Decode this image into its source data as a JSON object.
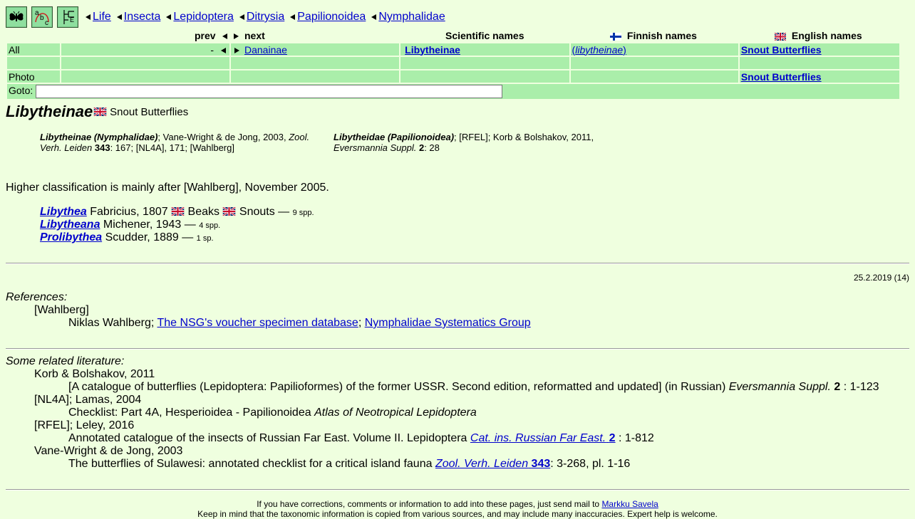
{
  "toolbar": {
    "icons": [
      "butterfly-icon",
      "abc-icon",
      "tree-icon"
    ],
    "abc_label": "abc"
  },
  "breadcrumbs": [
    {
      "label": "Life"
    },
    {
      "label": "Insecta"
    },
    {
      "label": "Lepidoptera"
    },
    {
      "label": "Ditrysia"
    },
    {
      "label": "Papilionoidea"
    },
    {
      "label": "Nymphalidae"
    }
  ],
  "nav": {
    "headers": {
      "prev": "prev",
      "next": "next",
      "scientific": "Scientific names",
      "finnish": "Finnish names",
      "english": "English names"
    },
    "rows": [
      {
        "label": "All",
        "prev": "-",
        "next": "Danainae",
        "scientific": "Libytheinae",
        "finnish": "(libytheinae)",
        "english": "Snout Butterflies"
      },
      {
        "label": "",
        "prev": "",
        "next": "",
        "scientific": "",
        "finnish": "",
        "english": ""
      },
      {
        "label": "Photo",
        "prev": "",
        "next": "",
        "scientific": "",
        "finnish": "",
        "english": "Snout Butterflies"
      }
    ],
    "goto_label": "Goto:",
    "goto_value": ""
  },
  "taxon": {
    "name": "Libytheinae",
    "common_name": "Snout Butterflies"
  },
  "synonyms": [
    {
      "name": "Libytheinae (Nymphalidae)",
      "rest1": "; Vane-Wright & de Jong, 2003, ",
      "journal1": "Zool.",
      "line2_journal": "Verh. Leiden",
      "volume": "343",
      "rest2": ": 167; [NL4A], 171; [Wahlberg]"
    },
    {
      "name": "Libytheidae (Papilionoidea)",
      "rest1": "; [RFEL]; Korb & Bolshakov, 2011,",
      "journal1": "",
      "line2_journal": "Eversmannia Suppl.",
      "volume": "2",
      "rest2": ": 28"
    }
  ],
  "higher_classification": "Higher classification is mainly after [Wahlberg], November 2005.",
  "genera": [
    {
      "name": "Libythea",
      "author": " Fabricius, 1807 ",
      "common1": "Beaks",
      "common2": "Snouts",
      "dash": " — ",
      "count": "9 spp."
    },
    {
      "name": "Libytheana",
      "author": " Michener, 1943",
      "dash": " — ",
      "count": "4 spp."
    },
    {
      "name": "Prolibythea",
      "author": " Scudder, 1889",
      "dash": " — ",
      "count": "1 sp."
    }
  ],
  "date": "25.2.2019 (14)",
  "references": {
    "title": "References:",
    "key": "[Wahlberg]",
    "author": "Niklas Wahlberg; ",
    "link1": "The NSG's voucher specimen database",
    "sep": "; ",
    "link2": "Nymphalidae Systematics Group"
  },
  "literature": {
    "title": "Some related literature:",
    "items": [
      {
        "head": "Korb & Bolshakov, 2011",
        "text": "[A catalogue of butterflies (Lepidoptera: Papilioformes) of the former USSR. Second edition, reformatted and updated] (in Russian) ",
        "journal": "Eversmannia Suppl.",
        "volume": "2",
        "pages": " : 1-123",
        "linked": false
      },
      {
        "head": "[NL4A]; Lamas, 2004",
        "text": "Checklist: Part 4A, Hesperioidea - Papilionoidea ",
        "journal": "Atlas of Neotropical Lepidoptera",
        "volume": "",
        "pages": "",
        "linked": false
      },
      {
        "head": "[RFEL]; Leley, 2016",
        "text": "Annotated catalogue of the insects of Russian Far East. Volume II. Lepidoptera ",
        "journal": "Cat. ins. Russian Far East.",
        "volume": "2",
        "pages": " : 1-812",
        "linked": true
      },
      {
        "head": "Vane-Wright & de Jong, 2003",
        "text": "The butterflies of Sulawesi: annotated checklist for a critical island fauna ",
        "journal": "Zool. Verh. Leiden",
        "volume": "343",
        "pages": ": 3-268, pl. 1-16",
        "linked": true
      }
    ]
  },
  "footer": {
    "line1": "If you have corrections, comments or information to add into these pages, just send mail to ",
    "contact": "Markku Savela",
    "line2": "Keep in mind that the taxonomic information is copied from various sources, and may include many inaccuracies. Expert help is welcome."
  },
  "colors": {
    "background": "#efffdf",
    "table_cell": "#aaeeaa",
    "link": "#0000cc",
    "tool_button": "#7fcf8f"
  }
}
